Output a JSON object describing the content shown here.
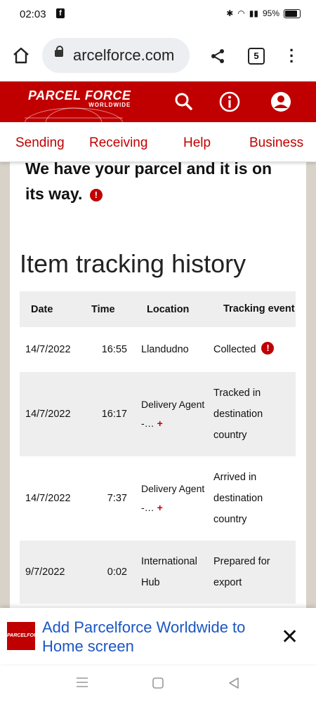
{
  "status": {
    "time": "02:03",
    "battery": "95%"
  },
  "browser": {
    "url": "arcelforce.com",
    "tab_count": "5"
  },
  "header": {
    "logo_main": "PARCEL FORCE",
    "logo_sub": "WORLDWIDE"
  },
  "nav": {
    "items": [
      "Sending",
      "Receiving",
      "Help",
      "Business"
    ]
  },
  "message": {
    "text": "We have your parcel and it is on its way."
  },
  "history": {
    "title": "Item tracking history",
    "headers": [
      "Date",
      "Time",
      "Location",
      "Tracking event"
    ],
    "rows": [
      {
        "date": "14/7/2022",
        "time": "16:55",
        "location": "Llandudno",
        "event": "Collected"
      },
      {
        "date": "14/7/2022",
        "time": "16:17",
        "location": "Delivery Agent -…",
        "event": "Tracked in destination country"
      },
      {
        "date": "14/7/2022",
        "time": "7:37",
        "location": "Delivery Agent -…",
        "event": "Arrived in destination country"
      },
      {
        "date": "9/7/2022",
        "time": "0:02",
        "location": "International Hub",
        "event": "Prepared for export"
      }
    ]
  },
  "banner": {
    "text": "Add Parcelforce Worldwide to Home screen",
    "icon_text": "PARCELFORCE"
  },
  "icons": {
    "warning": "!",
    "plus": "+",
    "close": "✕"
  }
}
